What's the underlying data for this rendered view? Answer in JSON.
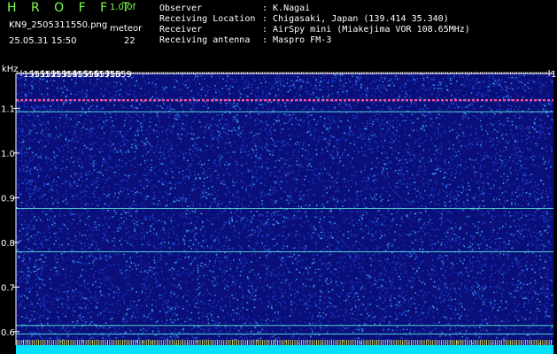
{
  "header": {
    "app_title": "H R O F F T",
    "version": "1.0.0f",
    "filename": "KN9_2505311550.png",
    "meteor_label": "meteor",
    "timestamp": "25.05.31 15:50",
    "meteor_count": "22"
  },
  "info": [
    {
      "key": "Observer",
      "value": ": K.Nagai"
    },
    {
      "key": "Receiving Location",
      "value": ": Chigasaki, Japan (139.414 35.340)"
    },
    {
      "key": "Receiver",
      "value": ": AirSpy mini (Miakejima VOR 108.65MHz)"
    },
    {
      "key": "Receiving antenna",
      "value": ": Maspro FM-3"
    }
  ],
  "chart_data": {
    "type": "heatmap",
    "ylabel": "kHz",
    "x_ticks": [
      "1551",
      "1552",
      "1553",
      "1554",
      "1555",
      "1556",
      "1557",
      "1558",
      "1559",
      "1600"
    ],
    "x_tick_values": [
      1551,
      1552,
      1553,
      1554,
      1555,
      1556,
      1557,
      1558,
      1559,
      1600
    ],
    "x_range": [
      1550.5,
      1600.4
    ],
    "y_ticks": [
      "1.1",
      "1.0",
      "0.9",
      "0.8",
      "0.7",
      "0.6"
    ],
    "y_tick_values": [
      1.1,
      1.0,
      0.9,
      0.8,
      0.7,
      0.6
    ],
    "y_range": [
      0.57,
      1.178
    ],
    "horizontal_lines_khz": [
      1.118,
      1.092,
      0.876,
      0.779,
      0.614,
      0.595
    ],
    "colors": {
      "background": "#0a0f7a",
      "noise_a": "#1e3cc8",
      "noise_b": "#38a0e8",
      "carrier": "#ff5aa0",
      "band_line": "#60ffe0",
      "bottom_bar": "#00e0ff",
      "text": "#ffffff",
      "accent": "#7CFF4A"
    }
  }
}
